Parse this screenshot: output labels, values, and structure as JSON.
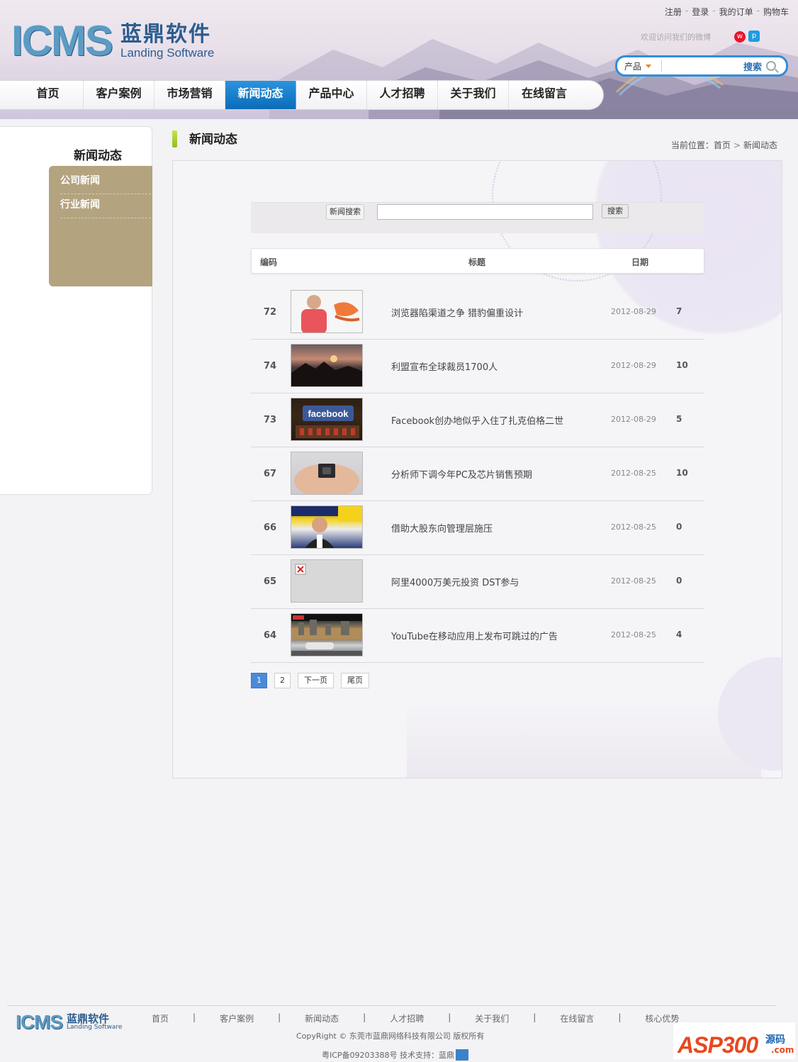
{
  "header": {
    "logo_mark": "ICMS",
    "logo_cn": "蓝鼎软件",
    "logo_en": "Landing Software",
    "top_links": [
      "注册",
      "登录",
      "我的订单",
      "购物车"
    ],
    "welcome": "欢迎访问我们的微博",
    "search": {
      "category": "产品",
      "button": "搜索",
      "value": ""
    }
  },
  "nav": [
    "首页",
    "客户案例",
    "市场营销",
    "新闻动态",
    "产品中心",
    "人才招聘",
    "关于我们",
    "在线留言"
  ],
  "nav_active": "新闻动态",
  "sidebar": {
    "title": "新闻动态",
    "items": [
      "公司新闻",
      "行业新闻"
    ]
  },
  "main": {
    "title": "新闻动态",
    "breadcrumb": {
      "prefix": "当前位置：",
      "home": "首页",
      "current": "新闻动态"
    },
    "search": {
      "label": "新闻搜索",
      "button": "搜索",
      "value": ""
    },
    "table": {
      "headers": {
        "code": "编码",
        "title": "标题",
        "date": "日期"
      },
      "rows": [
        {
          "code": "72",
          "title": "浏览器陷渠道之争 猎豹偏重设计",
          "date": "2012-08-29",
          "hits": "7",
          "thumb": "person-lobster-photo"
        },
        {
          "code": "74",
          "title": "利盟宣布全球裁员1700人",
          "date": "2012-08-29",
          "hits": "10",
          "thumb": "sunset-photo"
        },
        {
          "code": "73",
          "title": "Facebook创办地似乎入住了扎克伯格二世",
          "date": "2012-08-29",
          "hits": "5",
          "thumb": "facebook-sign-photo"
        },
        {
          "code": "67",
          "title": "分析师下调今年PC及芯片销售预期",
          "date": "2012-08-25",
          "hits": "10",
          "thumb": "chip-on-finger-photo"
        },
        {
          "code": "66",
          "title": "借助大股东向管理层施压",
          "date": "2012-08-25",
          "hits": "0",
          "thumb": "best-buy-person-photo"
        },
        {
          "code": "65",
          "title": "阿里4000万美元投资 DST参与",
          "date": "2012-08-25",
          "hits": "0",
          "thumb": "broken-image"
        },
        {
          "code": "64",
          "title": "YouTube在移动应用上发布可跳过的广告",
          "date": "2012-08-25",
          "hits": "4",
          "thumb": "phone-screenshot-photo"
        }
      ]
    },
    "pager": {
      "pages": [
        "1",
        "2"
      ],
      "current": "1",
      "next": "下一页",
      "last": "尾页"
    }
  },
  "footer": {
    "logo_mark": "ICMS",
    "logo_cn": "蓝鼎软件",
    "logo_en": "Landing Software",
    "links": [
      "首页",
      "客户案例",
      "新闻动态",
      "人才招聘",
      "关于我们",
      "在线留言",
      "核心优势"
    ],
    "copyright": "CopyRight © 东莞市蓝鼎网络科技有限公司 版权所有",
    "icp": "粤ICP备09203388号 技术支持：蓝鼎",
    "badge": {
      "a": "ASP300",
      "b": "源码",
      "c": ".com"
    }
  },
  "colors": {
    "nav_active": "#0b6cb8",
    "sidebar_menu": "#b3a37f",
    "pager_current": "#4a8bd8"
  }
}
